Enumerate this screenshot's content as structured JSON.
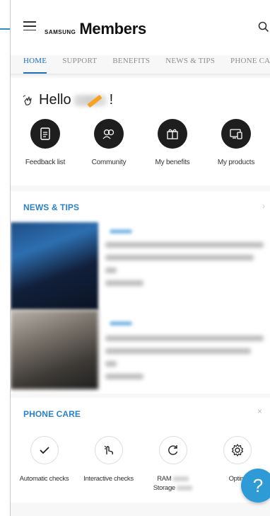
{
  "header": {
    "brand_small": "SAMSUNG",
    "brand_large": "Members"
  },
  "tabs": [
    "HOME",
    "SUPPORT",
    "BENEFITS",
    "NEWS & TIPS",
    "PHONE CARE"
  ],
  "active_tab": "HOME",
  "hello": {
    "greeting": "Hello",
    "punctuation": "!"
  },
  "quick_actions": [
    {
      "label": "Feedback list",
      "icon": "document-icon"
    },
    {
      "label": "Community",
      "icon": "community-icon"
    },
    {
      "label": "My benefits",
      "icon": "gift-icon"
    },
    {
      "label": "My products",
      "icon": "devices-icon"
    }
  ],
  "news": {
    "title": "NEWS & TIPS"
  },
  "phone_care": {
    "title": "PHONE CARE",
    "items": [
      {
        "label": "Automatic checks",
        "icon": "checkmark-icon"
      },
      {
        "label": "Interactive checks",
        "icon": "touch-icon"
      },
      {
        "label": "RAM",
        "label2": "Storage",
        "icon": "refresh-icon"
      },
      {
        "label": "Optim",
        "icon": "gear-icon"
      }
    ]
  },
  "fab": {
    "label": "?"
  },
  "colors": {
    "accent": "#2b82c8",
    "tab_active": "#1d6fb8",
    "fab": "#2e9bd6",
    "annotation": "#f6a320"
  }
}
